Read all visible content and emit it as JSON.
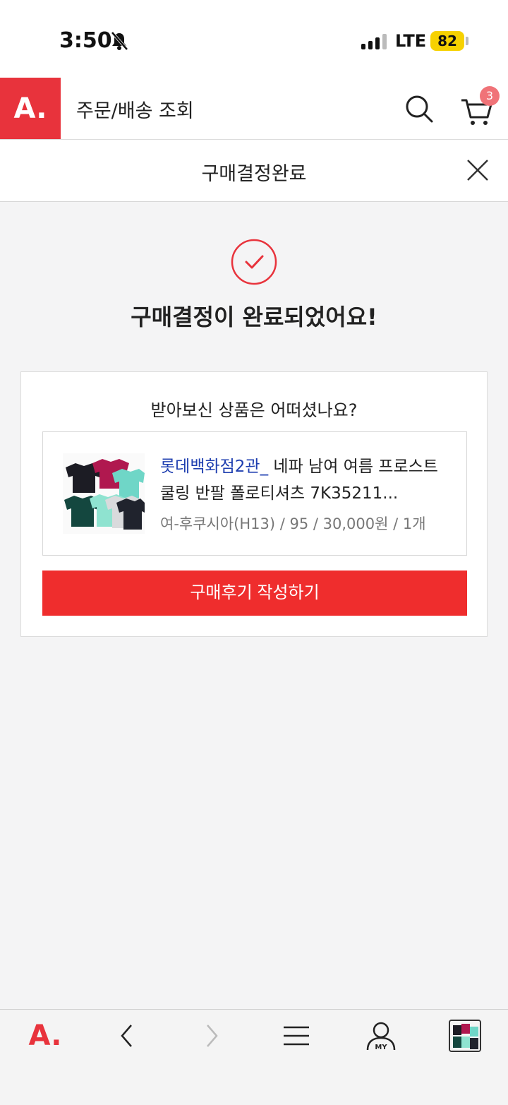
{
  "status_bar": {
    "time": "3:50",
    "network": "LTE",
    "battery": "82"
  },
  "header": {
    "logo": "A.",
    "title": "주문/배송 조회",
    "cart_count": "3"
  },
  "modal": {
    "title": "구매결정완료"
  },
  "confirmation": {
    "message": "구매결정이 완료되었어요!"
  },
  "card": {
    "question": "받아보신 상품은 어떠셨나요?",
    "product": {
      "store": "롯데백화점2관_",
      "name": " 네파 남여 여름 프로스트 쿨링 반팔 폴로티셔츠 7K35211...",
      "options": "여-후쿠시아(H13) / 95 / 30,000원 / 1개"
    },
    "review_button": "구매후기 작성하기"
  },
  "bottom_nav": {
    "logo": "A.",
    "my_label": "MY"
  },
  "colors": {
    "brand": "#e8333c",
    "button": "#ef2d2d",
    "link": "#1f3fb0"
  }
}
